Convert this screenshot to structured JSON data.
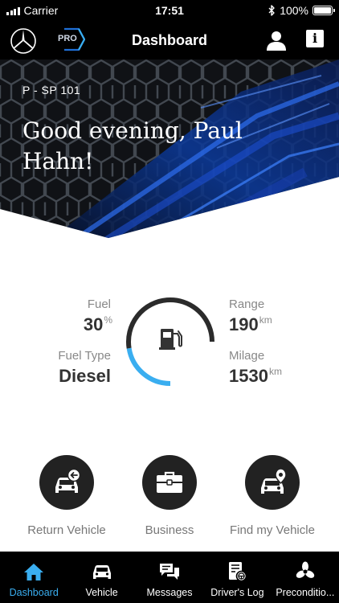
{
  "status_bar": {
    "carrier": "Carrier",
    "time": "17:51",
    "battery": "100%"
  },
  "nav": {
    "title": "Dashboard",
    "pro_badge": "PRO",
    "icons": [
      "mercedes-star-icon",
      "pro-hexagon-icon",
      "profile-icon",
      "info-icon"
    ]
  },
  "hero": {
    "plate": "P - SP 101",
    "greeting": "Good evening, Paul Hahn!"
  },
  "fuel": {
    "fuel_label": "Fuel",
    "fuel_value": "30",
    "fuel_unit": "%",
    "fuel_level": 0.3,
    "fuel_type_label": "Fuel Type",
    "fuel_type_value": "Diesel",
    "range_label": "Range",
    "range_value": "190",
    "range_unit": "km",
    "milage_label": "Milage",
    "milage_value": "1530",
    "milage_unit": "km",
    "gauge_icon": "fuel-pump-icon"
  },
  "actions": [
    {
      "label": "Return Vehicle",
      "icon": "return-car-icon"
    },
    {
      "label": "Business",
      "icon": "briefcase-icon"
    },
    {
      "label": "Find my Vehicle",
      "icon": "car-location-icon"
    }
  ],
  "tabs": [
    {
      "label": "Dashboard",
      "icon": "home-icon",
      "active": true
    },
    {
      "label": "Vehicle",
      "icon": "car-icon",
      "active": false
    },
    {
      "label": "Messages",
      "icon": "messages-icon",
      "active": false
    },
    {
      "label": "Driver's Log",
      "icon": "logbook-icon",
      "active": false
    },
    {
      "label": "Preconditio...",
      "icon": "fan-icon",
      "active": false
    }
  ],
  "colors": {
    "accent": "#3aaef0",
    "bar_background": "#000000",
    "action_circle": "#222222",
    "gauge_track": "#2b2b2b"
  }
}
